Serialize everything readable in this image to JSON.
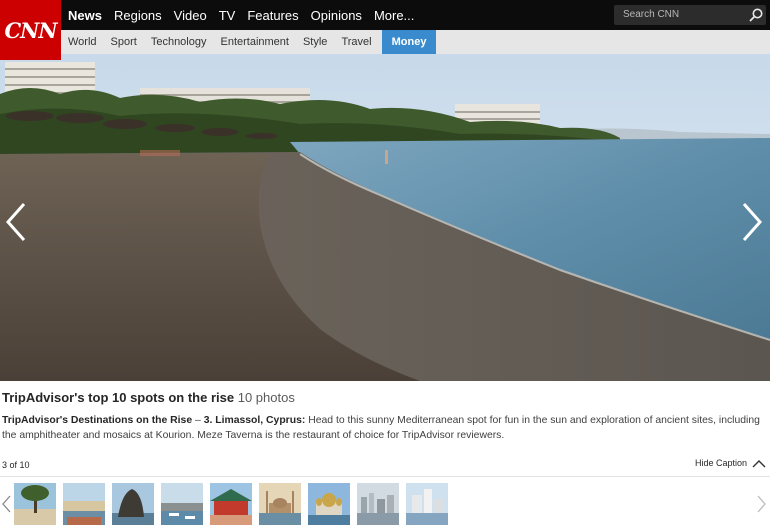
{
  "brand": {
    "logo_text": "CNN",
    "logo_color": "#cc0000"
  },
  "main_nav": [
    {
      "label": "News",
      "active": true
    },
    {
      "label": "Regions"
    },
    {
      "label": "Video"
    },
    {
      "label": "TV"
    },
    {
      "label": "Features"
    },
    {
      "label": "Opinions"
    },
    {
      "label": "More..."
    }
  ],
  "search": {
    "placeholder": "Search CNN"
  },
  "sub_nav": [
    {
      "label": "World"
    },
    {
      "label": "Sport"
    },
    {
      "label": "Technology"
    },
    {
      "label": "Entertainment"
    },
    {
      "label": "Style"
    },
    {
      "label": "Travel"
    },
    {
      "label": "Money",
      "highlighted": true,
      "color": "#3a8bcd"
    }
  ],
  "gallery": {
    "title": "TripAdvisor's top 10 spots on the rise",
    "photo_count": "10 photos",
    "caption_lead": "TripAdvisor's Destinations on the Rise",
    "caption_dash": " – ",
    "caption_place": "3. Limassol, Cyprus:",
    "caption_body": " Head to this sunny Mediterranean spot for fun in the sun and exploration of ancient sites, including the amphitheater and mosaics at Kourion. Meze Taverna is the restaurant of choice for TripAdvisor reviewers.",
    "counter": "3 of 10",
    "hide_caption": "Hide Caption",
    "thumbnails": [
      {
        "name": "beach-tree"
      },
      {
        "name": "coastal-town"
      },
      {
        "name": "rock-formation"
      },
      {
        "name": "harbor-boats"
      },
      {
        "name": "red-temple"
      },
      {
        "name": "mosque-waterfront"
      },
      {
        "name": "domed-cathedral"
      },
      {
        "name": "city-skyline"
      },
      {
        "name": "modern-waterfront"
      }
    ]
  }
}
